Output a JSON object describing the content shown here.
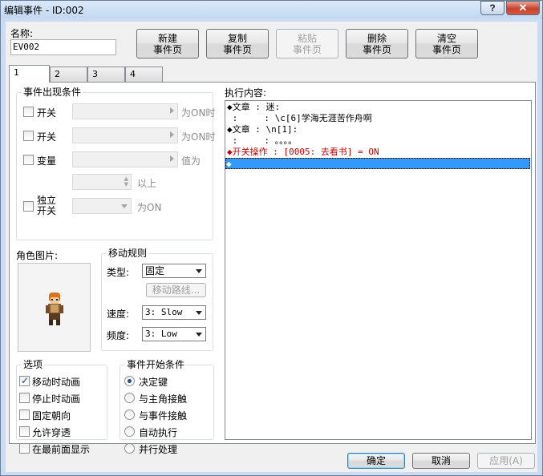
{
  "window": {
    "title": "编辑事件 - ID:002",
    "help_label": "?",
    "close_label": "✕"
  },
  "name": {
    "label": "名称:",
    "value": "EV002"
  },
  "page_buttons": {
    "new": "新建\n事件页",
    "copy": "复制\n事件页",
    "paste": "粘贴\n事件页",
    "delete": "删除\n事件页",
    "clear": "清空\n事件页"
  },
  "tabs": [
    "1",
    "2",
    "3",
    "4"
  ],
  "conditions": {
    "title": "事件出现条件",
    "switch1_label": "开关",
    "switch1_suffix": "为ON时",
    "switch2_label": "开关",
    "switch2_suffix": "为ON时",
    "variable_label": "变量",
    "variable_suffix": "值为",
    "variable_cmp_suffix": "以上",
    "self_switch_label": "独立\n开关",
    "self_switch_suffix": "为ON"
  },
  "graphic": {
    "label": "角色图片:"
  },
  "movement": {
    "title": "移动规则",
    "type_label": "类型:",
    "type_value": "固定",
    "route_button": "移动路线...",
    "speed_label": "速度:",
    "speed_value": "3: Slow",
    "freq_label": "频度:",
    "freq_value": "3: Low"
  },
  "options": {
    "title": "选项",
    "items": [
      {
        "label": "移动时动画",
        "checked": true
      },
      {
        "label": "停止时动画",
        "checked": false
      },
      {
        "label": "固定朝向",
        "checked": false
      },
      {
        "label": "允许穿透",
        "checked": false
      },
      {
        "label": "在最前面显示",
        "checked": false
      }
    ]
  },
  "trigger": {
    "title": "事件开始条件",
    "items": [
      {
        "label": "决定键",
        "checked": true
      },
      {
        "label": "与主角接触",
        "checked": false
      },
      {
        "label": "与事件接触",
        "checked": false
      },
      {
        "label": "自动执行",
        "checked": false
      },
      {
        "label": "并行处理",
        "checked": false
      }
    ]
  },
  "contents": {
    "label": "执行内容:",
    "lines": [
      {
        "text": "◆文章 : 迷:",
        "style": "normal"
      },
      {
        "text": " :     : \\c[6]学海无涯苦作舟啊",
        "style": "normal"
      },
      {
        "text": "◆文章 : \\n[1]:",
        "style": "normal"
      },
      {
        "text": " :     : 。。。。",
        "style": "normal"
      },
      {
        "text": "◆开关操作 : [0005: 去看书] = ON",
        "style": "red"
      },
      {
        "text": "◆",
        "style": "selected"
      }
    ]
  },
  "footer": {
    "ok": "确定",
    "cancel": "取消",
    "apply": "应用(A)"
  },
  "colors": {
    "selection": "#3399ff",
    "switch_op_text": "#c00000"
  }
}
